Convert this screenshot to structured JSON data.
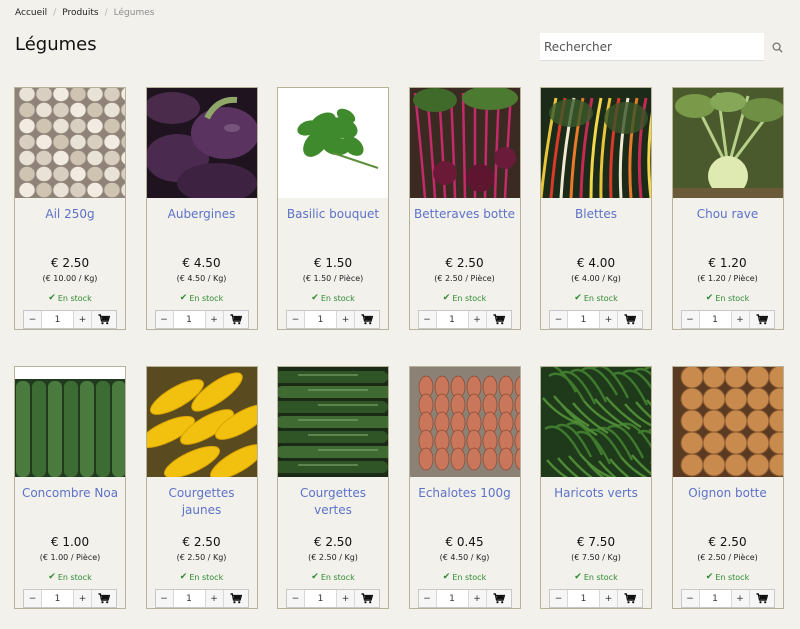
{
  "breadcrumb": {
    "items": [
      "Accueil",
      "Produits",
      "Légumes"
    ],
    "separator": "/"
  },
  "page": {
    "title": "Légumes"
  },
  "search": {
    "placeholder": "Rechercher"
  },
  "stock_label": "En stock",
  "controls": {
    "minus": "−",
    "plus": "+",
    "default_qty": "1"
  },
  "products": [
    {
      "name": "Ail 250g",
      "price": "€ 2.50",
      "unit_price": "(€ 10.00 / Kg)",
      "image": "garlic"
    },
    {
      "name": "Aubergines",
      "price": "€ 4.50",
      "unit_price": "(€ 4.50 / Kg)",
      "image": "eggplant"
    },
    {
      "name": "Basilic bouquet",
      "price": "€ 1.50",
      "unit_price": "(€ 1.50 / Pièce)",
      "image": "basil"
    },
    {
      "name": "Betteraves botte",
      "price": "€ 2.50",
      "unit_price": "(€ 2.50 / Pièce)",
      "image": "beetroot"
    },
    {
      "name": "Blettes",
      "price": "€ 4.00",
      "unit_price": "(€ 4.00 / Kg)",
      "image": "chard"
    },
    {
      "name": "Chou rave",
      "price": "€ 1.20",
      "unit_price": "(€ 1.20 / Pièce)",
      "image": "kohlrabi"
    },
    {
      "name": "Concombre Noa",
      "price": "€ 1.00",
      "unit_price": "(€ 1.00 / Pièce)",
      "image": "cucumber"
    },
    {
      "name": "Courgettes jaunes",
      "price": "€ 2.50",
      "unit_price": "(€ 2.50 / Kg)",
      "image": "yellow-zucchini"
    },
    {
      "name": "Courgettes vertes",
      "price": "€ 2.50",
      "unit_price": "(€ 2.50 / Kg)",
      "image": "green-zucchini"
    },
    {
      "name": "Echalotes 100g",
      "price": "€ 0.45",
      "unit_price": "(€ 4.50 / Kg)",
      "image": "shallots"
    },
    {
      "name": "Haricots verts",
      "price": "€ 7.50",
      "unit_price": "(€ 7.50 / Kg)",
      "image": "green-beans"
    },
    {
      "name": "Oignon botte",
      "price": "€ 2.50",
      "unit_price": "(€ 2.50 / Pièce)",
      "image": "onions"
    }
  ],
  "colors": {
    "background": "#f2f1ec",
    "product_link": "#5d72c8",
    "stock_green": "#2f8a2f",
    "card_border": "#b9b29b"
  },
  "icons": {
    "search": "search-icon",
    "cart": "cart-icon",
    "check": "check-icon"
  }
}
